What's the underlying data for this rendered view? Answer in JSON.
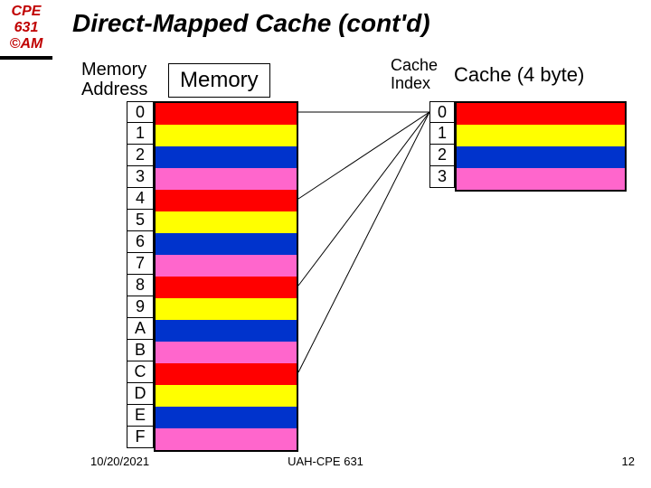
{
  "sidebar": {
    "line1": "CPE",
    "line2": "631",
    "line3": "©AM"
  },
  "title": "Direct-Mapped Cache (cont'd)",
  "labels": {
    "mem_addr_l1": "Memory",
    "mem_addr_l2": "Address",
    "memory": "Memory",
    "cache_idx_l1": "Cache",
    "cache_idx_l2": "Index",
    "cache": "Cache (4 byte)"
  },
  "memory_addresses": [
    "0",
    "1",
    "2",
    "3",
    "4",
    "5",
    "6",
    "7",
    "8",
    "9",
    "A",
    "B",
    "C",
    "D",
    "E",
    "F"
  ],
  "memory_colors": [
    "red",
    "yellow",
    "blue",
    "pink",
    "red",
    "yellow",
    "blue",
    "pink",
    "red",
    "yellow",
    "blue",
    "pink",
    "red",
    "yellow",
    "blue",
    "pink"
  ],
  "cache_indices": [
    "0",
    "1",
    "2",
    "3"
  ],
  "cache_colors": [
    "red",
    "yellow",
    "blue",
    "pink"
  ],
  "footer": {
    "date": "10/20/2021",
    "center": "UAH-CPE 631",
    "page": "12"
  },
  "chart_data": {
    "type": "table",
    "title": "Direct-Mapped Cache mapping (16 memory addresses → 4 cache lines)",
    "memory": [
      {
        "addr": "0",
        "maps_to": 0,
        "color": "red"
      },
      {
        "addr": "1",
        "maps_to": 1,
        "color": "yellow"
      },
      {
        "addr": "2",
        "maps_to": 2,
        "color": "blue"
      },
      {
        "addr": "3",
        "maps_to": 3,
        "color": "pink"
      },
      {
        "addr": "4",
        "maps_to": 0,
        "color": "red"
      },
      {
        "addr": "5",
        "maps_to": 1,
        "color": "yellow"
      },
      {
        "addr": "6",
        "maps_to": 2,
        "color": "blue"
      },
      {
        "addr": "7",
        "maps_to": 3,
        "color": "pink"
      },
      {
        "addr": "8",
        "maps_to": 0,
        "color": "red"
      },
      {
        "addr": "9",
        "maps_to": 1,
        "color": "yellow"
      },
      {
        "addr": "A",
        "maps_to": 2,
        "color": "blue"
      },
      {
        "addr": "B",
        "maps_to": 3,
        "color": "pink"
      },
      {
        "addr": "C",
        "maps_to": 0,
        "color": "red"
      },
      {
        "addr": "D",
        "maps_to": 1,
        "color": "yellow"
      },
      {
        "addr": "E",
        "maps_to": 2,
        "color": "blue"
      },
      {
        "addr": "F",
        "maps_to": 3,
        "color": "pink"
      }
    ],
    "cache_size_bytes": 4
  }
}
